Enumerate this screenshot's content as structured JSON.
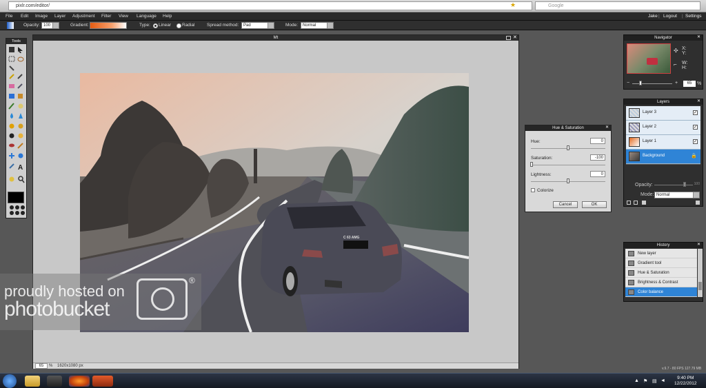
{
  "browser": {
    "url": "pixlr.com/editor/",
    "search_placeholder": "Google"
  },
  "menu": {
    "items": [
      "File",
      "Edit",
      "Image",
      "Layer",
      "Adjustment",
      "Filter",
      "View",
      "Language",
      "Help"
    ],
    "user": "Jake",
    "logout": "Logout",
    "settings": "Settings"
  },
  "options": {
    "opacity_label": "Opacity:",
    "opacity_value": "100",
    "gradient_label": "Gradient:",
    "type_label": "Type:",
    "type_linear": "Linear",
    "type_radial": "Radial",
    "spread_label": "Spread method:",
    "spread_value": "Pad",
    "mode_label": "Mode:",
    "mode_value": "Normal"
  },
  "tools": {
    "title": "Tools"
  },
  "canvas": {
    "title": "Mt",
    "zoom": "65",
    "zoom_unit": "%",
    "dimensions": "1620x1080 px",
    "plate": "C 63 AMG"
  },
  "navigator": {
    "title": "Navigator",
    "x_label": "X:",
    "y_label": "Y:",
    "w_label": "W:",
    "h_label": "H:",
    "zoom": "65",
    "zoom_unit": "%"
  },
  "layers": {
    "title": "Layers",
    "items": [
      {
        "name": "Layer 3",
        "checked": "✓"
      },
      {
        "name": "Layer 2",
        "checked": "✓"
      },
      {
        "name": "Layer 1",
        "checked": "✓"
      },
      {
        "name": "Background",
        "checked": ""
      }
    ],
    "opacity_label": "Opacity:",
    "opacity_value": "100",
    "mode_label": "Mode:",
    "mode_value": "Normal"
  },
  "dialog": {
    "title": "Hue & Saturation",
    "hue_label": "Hue:",
    "hue_value": "0",
    "saturation_label": "Saturation:",
    "saturation_value": "-100",
    "lightness_label": "Lightness:",
    "lightness_value": "0",
    "colorize_label": "Colorize",
    "cancel": "Cancel",
    "ok": "OK"
  },
  "history": {
    "title": "History",
    "items": [
      "New layer",
      "Gradient tool",
      "Hue & Saturation",
      "Brightness & Contrast",
      "Color balance"
    ]
  },
  "watermark": {
    "line1": "proudly hosted on",
    "line2": "photobucket",
    "mark": "®"
  },
  "status": {
    "version": "v.9.7 - 80 FPS 127.79 MB"
  },
  "taskbar": {
    "time": "9:40 PM",
    "date": "12/22/2012"
  },
  "colors": {
    "accent": "#2f84d6",
    "panel": "#2f2f2f",
    "workspace": "#575757"
  }
}
